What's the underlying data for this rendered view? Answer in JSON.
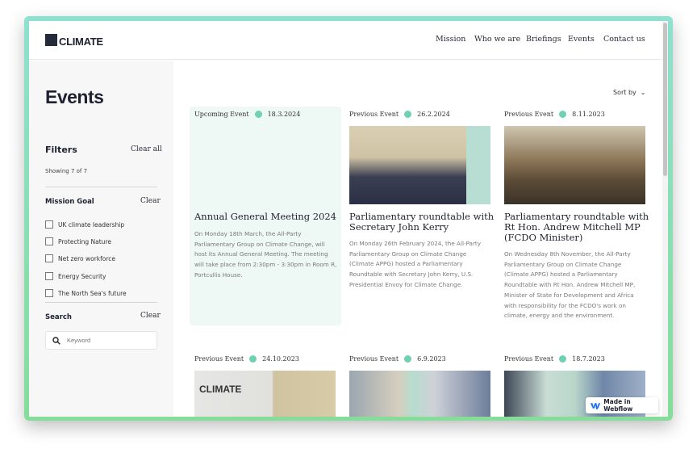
{
  "brand": {
    "logo_small": "appg",
    "logo_text": "CLIMATE"
  },
  "nav": [
    "Mission",
    "Who we are",
    "Briefings",
    "Events",
    "Contact us"
  ],
  "sidebar": {
    "title": "Events",
    "filters_label": "Filters",
    "clear_all": "Clear all",
    "showing": "Showing 7 of 7",
    "mission_goal": {
      "label": "Mission Goal",
      "clear": "Clear",
      "options": [
        "UK climate leadership",
        "Protecting Nature",
        "Net zero workforce",
        "Energy Security",
        "The North Sea's future"
      ]
    },
    "search": {
      "label": "Search",
      "clear": "Clear",
      "placeholder": "Keyword"
    }
  },
  "sort": {
    "label": "Sort by"
  },
  "accent": "#6fd2ae",
  "events": [
    {
      "type": "Upcoming Event",
      "date": "18.3.2024",
      "title": "Annual General Meeting 2024",
      "body": "On Monday 18th March, the All-Party Parliamentary Group on Climate Change, will host its Annual General Meeting. The meeting will take place from 2:30pm - 3:30pm in Room R, Portcullis House."
    },
    {
      "type": "Previous Event",
      "date": "26.2.2024",
      "title": "Parliamentary roundtable with Secretary John Kerry",
      "body": "On Monday 26th February 2024, the All-Party Parliamentary Group on Climate Change (Climate APPG) hosted a Parliamentary Roundtable with Secretary John Kerry, U.S. Presidential Envoy for Climate Change."
    },
    {
      "type": "Previous Event",
      "date": "8.11.2023",
      "title": "Parliamentary roundtable with Rt Hon. Andrew Mitchell MP (FCDO Minister)",
      "body": "On Wednesday 8th November, the All-Party Parliamentary Group on Climate Change (Climate APPG) hosted a Parliamentary Roundtable with Rt Hon. Andrew Mitchell MP, Minister of State for Development and Africa with responsibility for the FCDO's work on climate, energy and the environment."
    },
    {
      "type": "Previous Event",
      "date": "24.10.2023",
      "image_text": "CLIMATE"
    },
    {
      "type": "Previous Event",
      "date": "6.9.2023"
    },
    {
      "type": "Previous Event",
      "date": "18.7.2023"
    }
  ],
  "webflow_badge": "Made in Webflow"
}
